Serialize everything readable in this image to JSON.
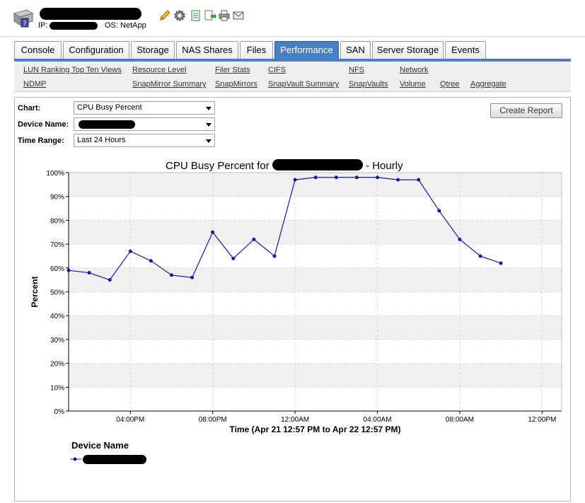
{
  "header": {
    "ip_label": "IP:",
    "os_label": "OS: NetApp"
  },
  "icons": [
    "device-icon",
    "pencil-icon",
    "gear-icon",
    "report-icon",
    "export-icon",
    "printer-icon",
    "email-icon"
  ],
  "tabs": [
    {
      "label": "Console"
    },
    {
      "label": "Configuration"
    },
    {
      "label": "Storage"
    },
    {
      "label": "NAS Shares"
    },
    {
      "label": "Files"
    },
    {
      "label": "Performance",
      "active": true
    },
    {
      "label": "SAN"
    },
    {
      "label": "Server Storage"
    },
    {
      "label": "Events"
    }
  ],
  "subnav": [
    {
      "label": "LUN Ranking Top Ten Views"
    },
    {
      "label": "Resource Level"
    },
    {
      "label": "Filer Stats"
    },
    {
      "label": "CIFS"
    },
    {
      "label": "NFS"
    },
    {
      "label": "Network"
    },
    {
      "label": "NDMP"
    },
    {
      "label": "SnapMirror Summary"
    },
    {
      "label": "SnapMirrors"
    },
    {
      "label": "SnapVault Summary"
    },
    {
      "label": "SnapVaults"
    },
    {
      "label": "Volume"
    },
    {
      "label": "Qtree"
    },
    {
      "label": "Aggregate"
    }
  ],
  "form": {
    "chart_label": "Chart:",
    "chart_value": "CPU Busy Percent",
    "device_label": "Device Name:",
    "time_label": "Time Range:",
    "time_value": "Last 24 Hours",
    "create_report": "Create Report"
  },
  "colors": {
    "accent": "#4a7fc0",
    "series": "#1a1a8c",
    "band": "#f0f0f0"
  },
  "chart_data": {
    "type": "line",
    "title_prefix": "CPU Busy Percent for",
    "title_suffix": "- Hourly",
    "xlabel": "Time (Apr 21 12:57 PM to Apr 22 12:57 PM)",
    "ylabel": "Percent",
    "ylim": [
      0,
      100
    ],
    "yticks": [
      "0%",
      "10%",
      "20%",
      "30%",
      "40%",
      "50%",
      "60%",
      "70%",
      "80%",
      "90%",
      "100%"
    ],
    "xlim": [
      13.0,
      36.95
    ],
    "xticks": [
      {
        "label": "04:00PM",
        "hour": 16
      },
      {
        "label": "08:00PM",
        "hour": 20
      },
      {
        "label": "12:00AM",
        "hour": 24
      },
      {
        "label": "04:00AM",
        "hour": 28
      },
      {
        "label": "08:00AM",
        "hour": 32
      },
      {
        "label": "12:00PM",
        "hour": 36
      }
    ],
    "grid": true,
    "legend_title": "Device Name",
    "legend_position": "bottom-left",
    "series": [
      {
        "hours": [
          13,
          14,
          15,
          16,
          17,
          18,
          19,
          20,
          21,
          22,
          23,
          24,
          25,
          26,
          27,
          28,
          29,
          30,
          31,
          32,
          33,
          34
        ],
        "values": [
          59,
          58,
          55,
          67,
          63,
          57,
          56,
          75,
          64,
          72,
          65,
          97,
          98,
          98,
          98,
          98,
          97,
          97,
          84,
          72,
          65,
          62
        ]
      }
    ]
  }
}
